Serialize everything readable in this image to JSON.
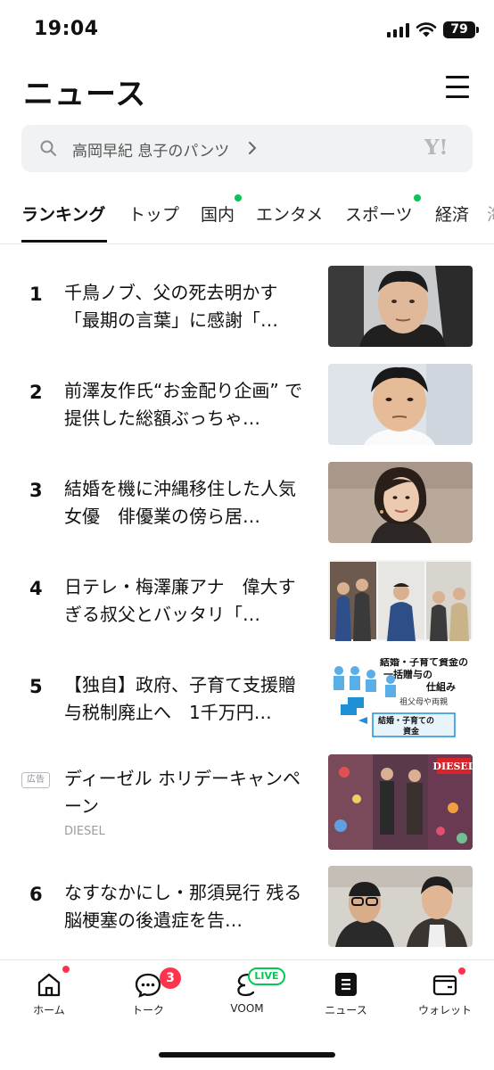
{
  "status_bar": {
    "time": "19:04",
    "battery": "79"
  },
  "header": {
    "title": "ニュース"
  },
  "search": {
    "query": "高岡早紀 息子のパンツ",
    "provider": "Y!"
  },
  "tabs": [
    {
      "label": "ランキング",
      "active": true
    },
    {
      "label": "トップ"
    },
    {
      "label": "国内",
      "dot": true
    },
    {
      "label": "エンタメ"
    },
    {
      "label": "スポーツ",
      "dot": true
    },
    {
      "label": "経済"
    }
  ],
  "news": [
    {
      "rank": "1",
      "headline": "千鳥ノブ、父の死去明かす「最期の言葉」に感謝「…",
      "thumb_icon": "photo-man-face"
    },
    {
      "rank": "2",
      "headline": "前澤友作氏“お金配り企画” で提供した総額ぶっちゃ…",
      "thumb_icon": "photo-man-face"
    },
    {
      "rank": "3",
      "headline": "結婚を機に沖縄移住した人気女優　俳優業の傍ら居…",
      "thumb_icon": "photo-woman-portrait"
    },
    {
      "rank": "4",
      "headline": "日テレ・梅澤廉アナ　偉大すぎる叔父とバッタリ「…",
      "thumb_icon": "photo-group"
    },
    {
      "rank": "5",
      "headline": "【独自】政府、子育て支援贈与税制廃止へ　1千万円…",
      "thumb_icon": "diagram-illustration",
      "thumb_text": {
        "line1": "結婚・子育て資金の",
        "line2": "一括贈与の",
        "line3": "仕組み",
        "side": "祖父母や両親",
        "box1": "結婚・子育ての",
        "box2": "資金"
      }
    },
    {
      "ad": true,
      "ad_label": "広告",
      "headline": "ディーゼル ホリデーキャンペーン",
      "source": "DIESEL",
      "brand_logo": "DIESEL",
      "thumb_icon": "photo-holiday-ad"
    },
    {
      "rank": "6",
      "headline": "なすなかにし・那須晃行 残る脳梗塞の後遺症を告…",
      "thumb_icon": "photo-two-men"
    }
  ],
  "bottom_nav": [
    {
      "label": "ホーム",
      "icon": "home-icon",
      "dot": true
    },
    {
      "label": "トーク",
      "icon": "chat-icon",
      "badge": "3"
    },
    {
      "label": "VOOM",
      "icon": "voom-icon",
      "live": "LIVE"
    },
    {
      "label": "ニュース",
      "icon": "news-icon",
      "active": true
    },
    {
      "label": "ウォレット",
      "icon": "wallet-icon",
      "dot": true
    }
  ],
  "colors": {
    "accent_green": "#06c755",
    "alert_red": "#ff334b",
    "text": "#111111"
  }
}
